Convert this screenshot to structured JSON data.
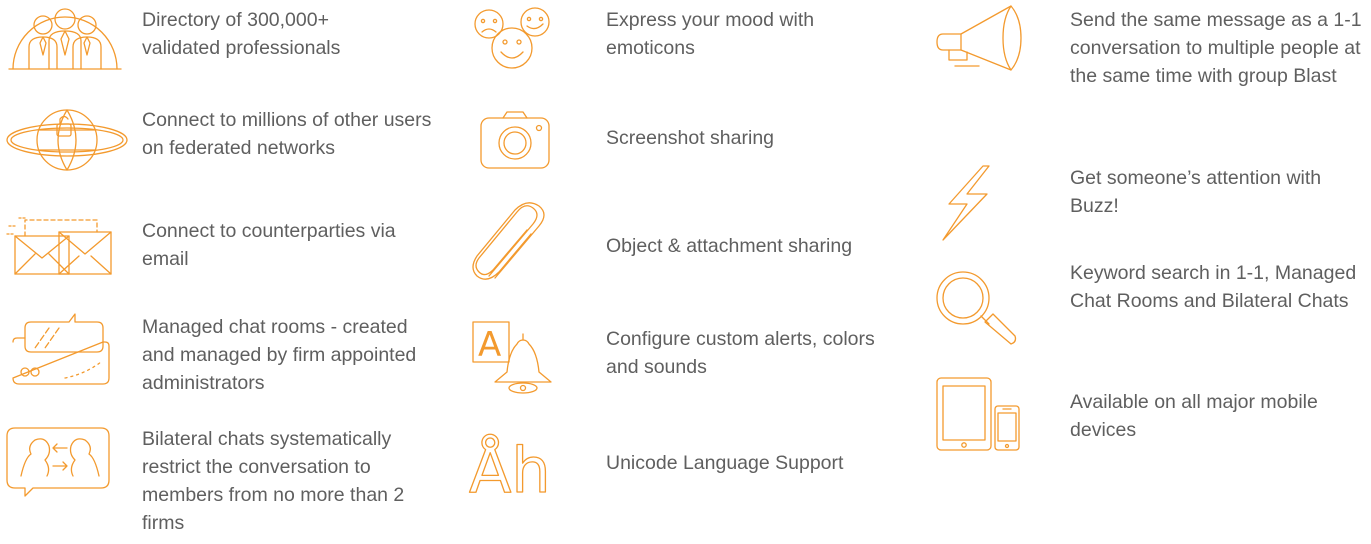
{
  "columns": [
    {
      "features": [
        {
          "icon": "people-icon",
          "text": "Directory of 300,000+ validated professionals"
        },
        {
          "icon": "globe-network-icon",
          "text": "Connect to millions of other users on federated networks"
        },
        {
          "icon": "email-envelopes-icon",
          "text": "Connect to counterparties via email"
        },
        {
          "icon": "chat-room-icon",
          "text": "Managed chat rooms - created and managed by firm appointed administrators"
        },
        {
          "icon": "bilateral-chat-icon",
          "text": "Bilateral chats systematically restrict the conversation to members from no more than 2 firms"
        }
      ]
    },
    {
      "features": [
        {
          "icon": "emoticons-icon",
          "text": "Express your mood with emoticons"
        },
        {
          "icon": "camera-icon",
          "text": "Screenshot sharing"
        },
        {
          "icon": "paperclip-icon",
          "text": "Object & attachment sharing"
        },
        {
          "icon": "alert-bell-icon",
          "text": "Configure custom alerts, colors and sounds"
        },
        {
          "icon": "unicode-letters-icon",
          "text": "Unicode Language  Support"
        }
      ]
    },
    {
      "features": [
        {
          "icon": "megaphone-icon",
          "text": "Send the same message as a 1-1 conversation to multiple people at the same time with group Blast"
        },
        {
          "icon": "lightning-icon",
          "text": "Get someone’s attention with Buzz!"
        },
        {
          "icon": "magnifier-icon",
          "text": "Keyword search in 1-1, Managed Chat Rooms and Bilateral Chats"
        },
        {
          "icon": "mobile-devices-icon",
          "text": "Available on all major mobile devices"
        }
      ]
    }
  ],
  "colors": {
    "accent": "#f39a2e",
    "text": "#5f5f5f",
    "background": "#ffffff"
  }
}
